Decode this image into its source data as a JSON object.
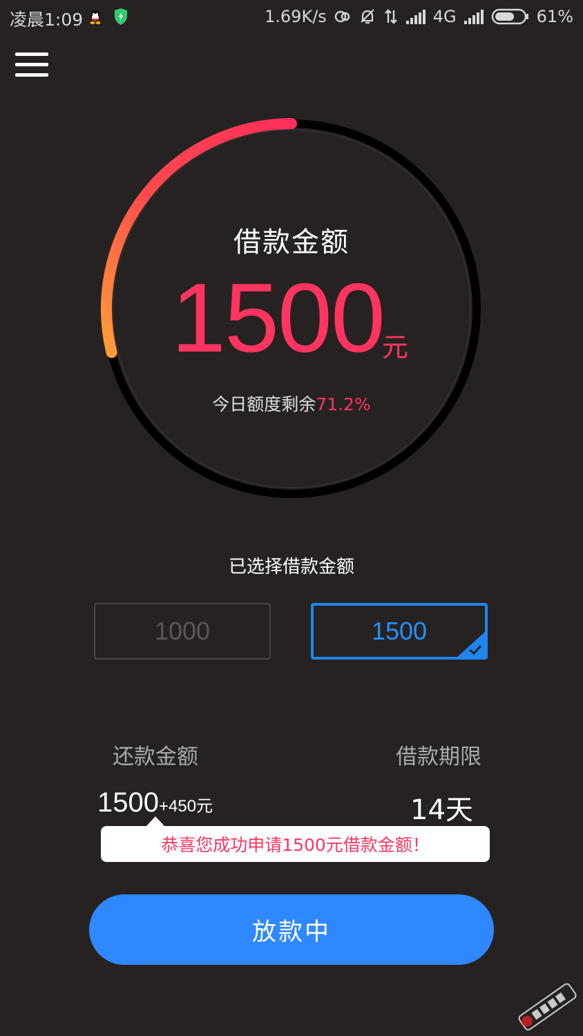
{
  "status_bar": {
    "time": "凌晨1:09",
    "network_speed": "1.69K/s",
    "network_type": "4G",
    "battery": "61%",
    "icons": [
      "qq-icon",
      "shield-icon",
      "sync-icon",
      "mute-icon",
      "data-arrows-icon",
      "signal-icon",
      "battery-icon"
    ]
  },
  "header": {
    "menu_icon": "menu-icon"
  },
  "dial": {
    "title": "借款金额",
    "amount": "1500",
    "unit": "元",
    "remain_label": "今日额度剩余",
    "remain_value": "71.2%",
    "progress_fraction": 0.288,
    "gradient_start_color": "#ff9e37",
    "gradient_end_color": "#ff2f5a"
  },
  "selection": {
    "label": "已选择借款金额",
    "options": [
      {
        "value": "1000",
        "selected": false
      },
      {
        "value": "1500",
        "selected": true
      }
    ]
  },
  "summary": {
    "repay_label": "还款金额",
    "repay_principal": "1500",
    "repay_extra": "+450元",
    "term_label": "借款期限",
    "term_value": "14天"
  },
  "toast": {
    "message": "恭喜您成功申请1500元借款金额！"
  },
  "cta": {
    "label": "放款中"
  },
  "colors": {
    "background": "#272222",
    "accent_red": "#ff3560",
    "accent_blue": "#2f88ff",
    "ring_track": "#000000"
  }
}
